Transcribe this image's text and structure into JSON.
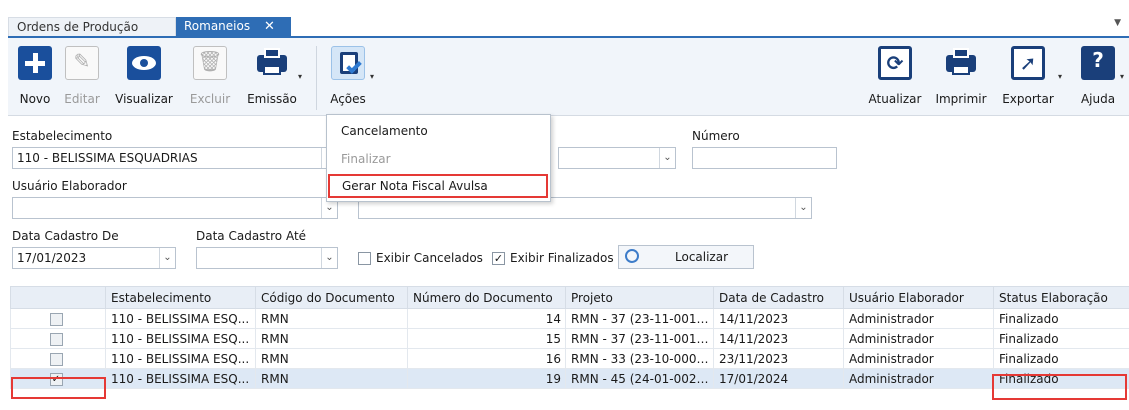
{
  "tabs": [
    {
      "label": "Ordens de Produção"
    },
    {
      "label": "Romaneios"
    }
  ],
  "tab_close_glyph": "✕",
  "toolbar": {
    "left": [
      {
        "label": "Novo",
        "icon": "plus-icon"
      },
      {
        "label": "Editar",
        "icon": "pencil-icon"
      },
      {
        "label": "Visualizar",
        "icon": "eye-icon"
      },
      {
        "label": "Excluir",
        "icon": "trash-icon"
      },
      {
        "label": "Emissão",
        "icon": "printer-icon"
      },
      {
        "label": "Ações",
        "icon": "clipboard-check-icon"
      }
    ],
    "right": [
      {
        "label": "Atualizar",
        "icon": "refresh-icon"
      },
      {
        "label": "Imprimir",
        "icon": "printer-icon"
      },
      {
        "label": "Exportar",
        "icon": "export-icon"
      },
      {
        "label": "Ajuda",
        "icon": "help-icon"
      }
    ]
  },
  "menu": {
    "items": [
      "Cancelamento",
      "Finalizar",
      "Gerar Nota Fiscal Avulsa"
    ]
  },
  "filters": {
    "estabelecimento_label": "Estabelecimento",
    "estabelecimento_value": "110 - BELISSIMA ESQUADRIAS",
    "numero_label": "Número",
    "numero_value": "",
    "usuario_label": "Usuário Elaborador",
    "usuario_value": "",
    "data_de_label": "Data Cadastro De",
    "data_de_value": "17/01/2023",
    "data_ate_label": "Data Cadastro Até",
    "data_ate_value": "",
    "exibir_cancelados": "Exibir Cancelados",
    "exibir_finalizados": "Exibir Finalizados",
    "localizar": "Localizar"
  },
  "grid": {
    "columns": [
      "",
      "Estabelecimento",
      "Código do Documento",
      "Número do Documento",
      "Projeto",
      "Data de Cadastro",
      "Usuário Elaborador",
      "Status Elaboração"
    ],
    "rows": [
      {
        "checked": "",
        "estab": "110 - BELISSIMA ESQ...",
        "codigo": "RMN",
        "numero": "14",
        "projeto": "RMN - 37 (23-11-0012...",
        "data": "14/11/2023",
        "usuario": "Administrador",
        "status": "Finalizado"
      },
      {
        "checked": "",
        "estab": "110 - BELISSIMA ESQ...",
        "codigo": "RMN",
        "numero": "15",
        "projeto": "RMN - 37 (23-11-0012...",
        "data": "14/11/2023",
        "usuario": "Administrador",
        "status": "Finalizado"
      },
      {
        "checked": "",
        "estab": "110 - BELISSIMA ESQ...",
        "codigo": "RMN",
        "numero": "16",
        "projeto": "RMN - 33 (23-10-0007...",
        "data": "23/11/2023",
        "usuario": "Administrador",
        "status": "Finalizado"
      },
      {
        "checked": "✓",
        "estab": "110 - BELISSIMA ESQ...",
        "codigo": "RMN",
        "numero": "19",
        "projeto": "RMN - 45 (24-01-0020...",
        "data": "17/01/2024",
        "usuario": "Administrador",
        "status": "Finalizado"
      }
    ]
  }
}
